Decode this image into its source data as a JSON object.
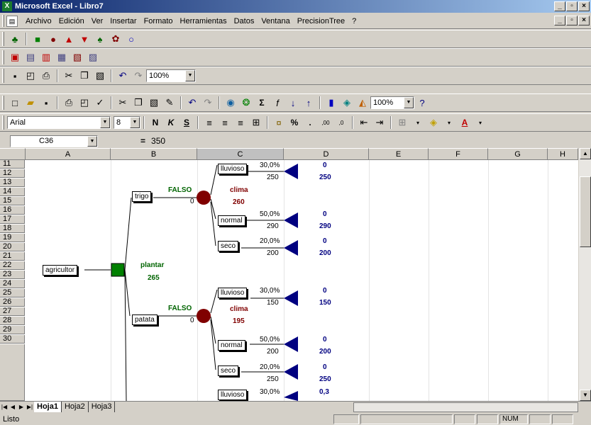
{
  "window": {
    "title": "Microsoft Excel - Libro7",
    "app_icon": "excel-icon"
  },
  "menu": [
    "Archivo",
    "Edición",
    "Ver",
    "Insertar",
    "Formato",
    "Herramientas",
    "Datos",
    "Ventana",
    "PrecisionTree",
    "?"
  ],
  "toolbar": {
    "zoom1": "100%",
    "zoom2": "100%",
    "font": "Arial",
    "size": "8",
    "bold": "N",
    "italic": "K",
    "underline": "S",
    "percent": "%",
    "comma": ".",
    "sigma": "Σ",
    "fx": "f",
    "dec_inc": ",00",
    "dec_dec": ",0"
  },
  "formula": {
    "cell_ref": "C36",
    "equals": "=",
    "value": "350"
  },
  "columns": [
    "A",
    "B",
    "C",
    "D",
    "E",
    "F",
    "G",
    "H"
  ],
  "rows": [
    "11",
    "12",
    "13",
    "14",
    "15",
    "16",
    "17",
    "18",
    "19",
    "20",
    "21",
    "22",
    "23",
    "24",
    "25",
    "26",
    "27",
    "28",
    "29",
    "30"
  ],
  "tree": {
    "root_label": "agricultor",
    "decision_label": "plantar",
    "decision_value": "265",
    "branches": [
      {
        "label": "trigo",
        "flag": "FALSO",
        "cost": "0",
        "chance_label": "clima",
        "chance_value": "260"
      },
      {
        "label": "patata",
        "flag": "FALSO",
        "cost": "0",
        "chance_label": "clima",
        "chance_value": "195"
      }
    ],
    "outcomes": [
      {
        "label": "lluvioso",
        "prob": "30,0%",
        "value": "250",
        "p": "0",
        "payoff": "250"
      },
      {
        "label": "normal",
        "prob": "50,0%",
        "value": "290",
        "p": "0",
        "payoff": "290"
      },
      {
        "label": "seco",
        "prob": "20,0%",
        "value": "200",
        "p": "0",
        "payoff": "200"
      },
      {
        "label": "lluvioso",
        "prob": "30,0%",
        "value": "150",
        "p": "0",
        "payoff": "150"
      },
      {
        "label": "normal",
        "prob": "50,0%",
        "value": "200",
        "p": "0",
        "payoff": "200"
      },
      {
        "label": "seco",
        "prob": "20,0%",
        "value": "250",
        "p": "0",
        "payoff": "250"
      },
      {
        "label": "lluvioso",
        "prob": "30,0%",
        "value": "",
        "p": "0,3",
        "payoff": ""
      }
    ]
  },
  "sheets": [
    "Hoja1",
    "Hoja2",
    "Hoja3"
  ],
  "status": {
    "text": "Listo",
    "num": "NUM"
  }
}
